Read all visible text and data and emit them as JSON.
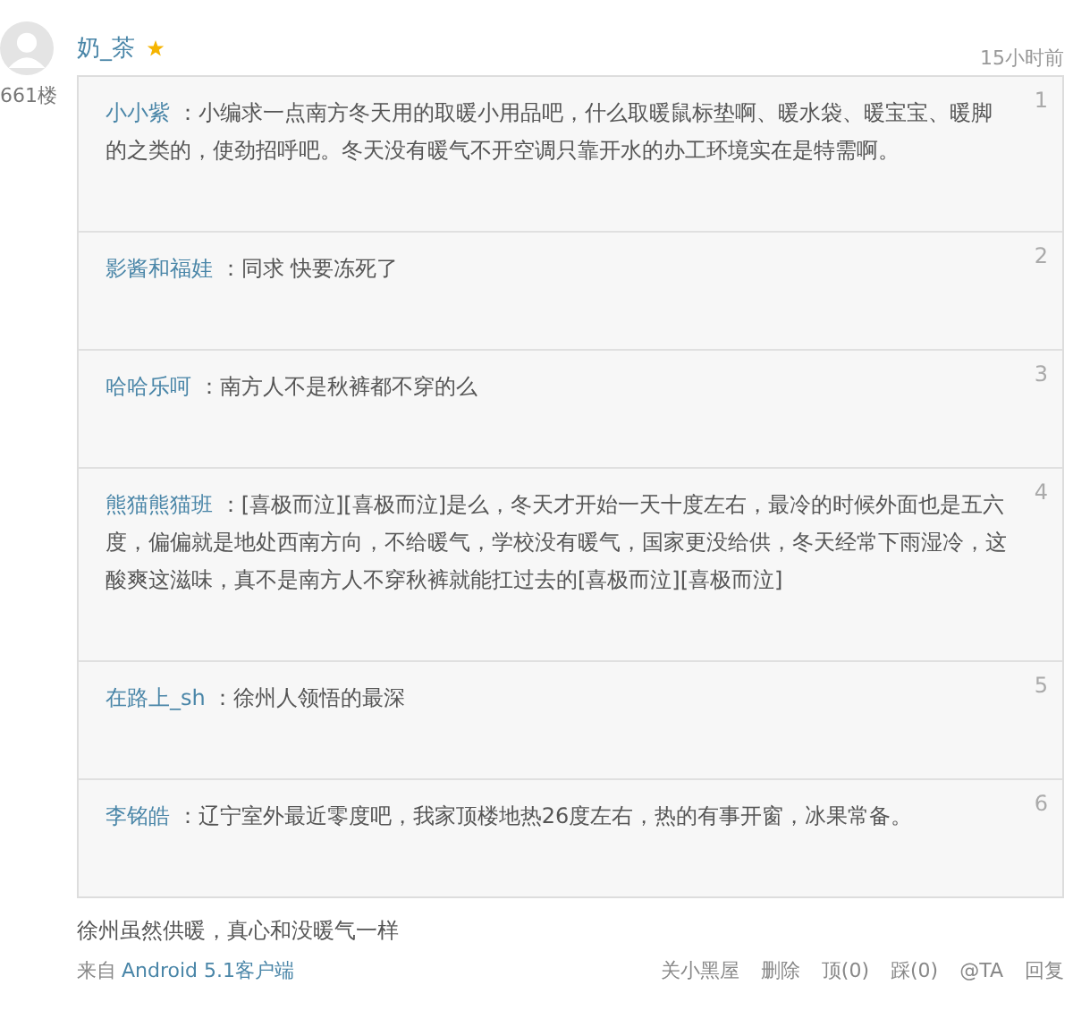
{
  "comment": {
    "author": "奶_茶",
    "starred": true,
    "floor": "661楼",
    "time": "15小时前",
    "quotes": [
      {
        "number": "1",
        "author": "小小紫",
        "text": " ：小编求一点南方冬天用的取暖小用品吧，什么取暖鼠标垫啊、暖水袋、暖宝宝、暖脚的之类的，使劲招呼吧。冬天没有暖气不开空调只靠开水的办工环境实在是特需啊。"
      },
      {
        "number": "2",
        "author": "影酱和福娃",
        "text": " ：同求 快要冻死了"
      },
      {
        "number": "3",
        "author": "哈哈乐呵",
        "text": " ：南方人不是秋裤都不穿的么"
      },
      {
        "number": "4",
        "author": "熊猫熊猫班",
        "text": " ：[喜极而泣][喜极而泣]是么，冬天才开始一天十度左右，最冷的时候外面也是五六度，偏偏就是地处西南方向，不给暖气，学校没有暖气，国家更没给供，冬天经常下雨湿冷，这酸爽这滋味，真不是南方人不穿秋裤就能扛过去的[喜极而泣][喜极而泣]"
      },
      {
        "number": "5",
        "author": "在路上_sh",
        "text": " ：徐州人领悟的最深"
      },
      {
        "number": "6",
        "author": "李铭皓",
        "text": " ：辽宁室外最近零度吧，我家顶楼地热26度左右，热的有事开窗，冰果常备。"
      }
    ],
    "text": "徐州虽然供暖，真心和没暖气一样",
    "source_prefix": "来自",
    "source_link": "Android 5.1客户端",
    "actions": [
      "关小黑屋",
      "删除",
      "顶(0)",
      "踩(0)",
      "@TA",
      "回复"
    ]
  }
}
